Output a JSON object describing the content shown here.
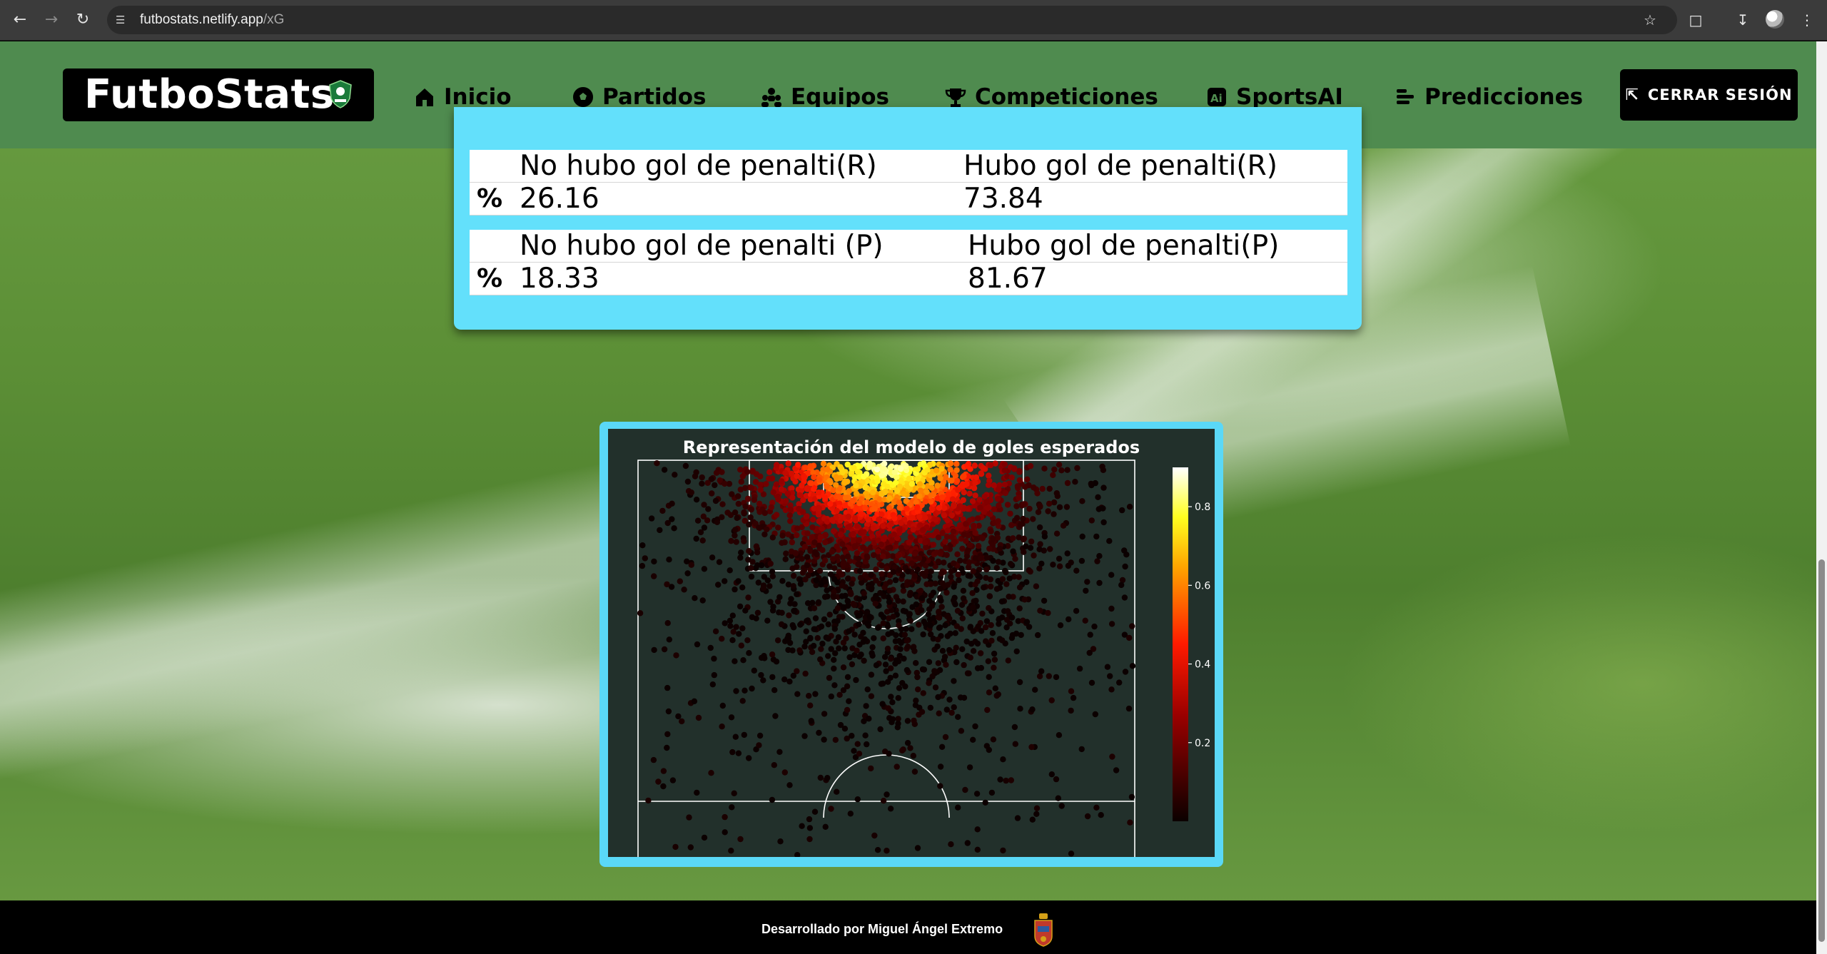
{
  "browser": {
    "url_host": "futbostats.netlify.app",
    "url_path": "/xG",
    "icons": [
      "back-icon",
      "forward-icon",
      "reload-icon",
      "site-info-icon",
      "star-icon",
      "extensions-icon",
      "download-icon",
      "profile-avatar",
      "menu-icon"
    ]
  },
  "header": {
    "logo_text": "FutboStats",
    "nav": [
      {
        "label": "Inicio",
        "icon": "home-icon"
      },
      {
        "label": "Partidos",
        "icon": "soccer-ball-icon"
      },
      {
        "label": "Equipos",
        "icon": "team-icon"
      },
      {
        "label": "Competiciones",
        "icon": "trophy-icon"
      },
      {
        "label": "SportsAI",
        "icon": "ai-icon"
      },
      {
        "label": "Predicciones",
        "icon": "bars-icon"
      }
    ],
    "logout_label": "CERRAR SESIÓN",
    "colors": {
      "header_bg": "#4f8b4f",
      "card_bg": "#63e0fb"
    }
  },
  "penalties": {
    "real": {
      "col1_header": "No hubo gol de penalti(R)",
      "col2_header": "Hubo gol de penalti(R)",
      "row_label": "%",
      "col1_value": "26.16",
      "col2_value": "73.84"
    },
    "predicted": {
      "col1_header": "No hubo gol de penalti (P)",
      "col2_header": "Hubo gol de penalti(P)",
      "row_label": "%",
      "col1_value": "18.33",
      "col2_value": "81.67"
    }
  },
  "chart_data": {
    "type": "scatter",
    "title": "Representación del modelo de goles esperados",
    "colorbar": {
      "ticks": [
        0.2,
        0.4,
        0.6,
        0.8
      ],
      "range": [
        0,
        0.9
      ],
      "colormap": "hot"
    },
    "legend_placement": "right",
    "grid": false,
    "note_series": "shot locations on half pitch colored by expected-goal value; density concentrated inside the penalty area, highest values near the goal"
  },
  "footer": {
    "credit": "Desarrollado por Miguel Ángel Extremo"
  }
}
